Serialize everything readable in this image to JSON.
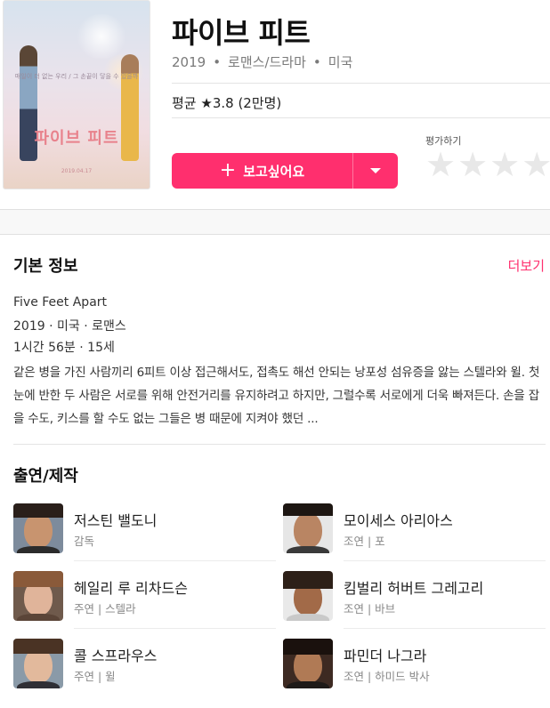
{
  "poster": {
    "title": "파이브 피트",
    "tagline": "매일이 더 없는 우리 / 그 손끝이 닿을 수 있을까",
    "date": "2019.04.17"
  },
  "movie": {
    "title": "파이브 피트",
    "year": "2019",
    "genre": "로맨스/드라마",
    "country": "미국",
    "rating_text": "평균 ★3.8 (2만명)"
  },
  "actions": {
    "want_label": "보고싶어요",
    "rate_label": "평가하기",
    "stars": [
      "★",
      "★",
      "★",
      "★"
    ]
  },
  "info": {
    "section_title": "기본 정보",
    "more_label": "더보기",
    "original_title": "Five Feet Apart",
    "line2": "2019 · 미국 · 로맨스",
    "line3": "1시간 56분 · 15세",
    "description": "같은 병을 가진 사람끼리 6피트 이상 접근해서도, 접촉도 해선 안되는 낭포성 섬유증을 앓는 스텔라와 윌. 첫눈에 반한 두 사람은 서로를 위해 안전거리를 유지하려고 하지만, 그럴수록 서로에게 더욱 빠져든다. 손을 잡을 수도, 키스를 할 수도 없는 그들은 병 때문에 지켜야 했던 ..."
  },
  "cast": {
    "section_title": "출연/제작",
    "people": [
      {
        "name": "저스틴 밸도니",
        "role": "감독"
      },
      {
        "name": "모이세스 아리아스",
        "role": "조연 | 포"
      },
      {
        "name": "헤일리 루 리차드슨",
        "role": "주연 | 스텔라"
      },
      {
        "name": "킴벌리 허버트 그레고리",
        "role": "조연 | 바브"
      },
      {
        "name": "콜 스프라우스",
        "role": "주연 | 윌"
      },
      {
        "name": "파민더 나그라",
        "role": "조연 | 하미드 박사"
      }
    ]
  }
}
